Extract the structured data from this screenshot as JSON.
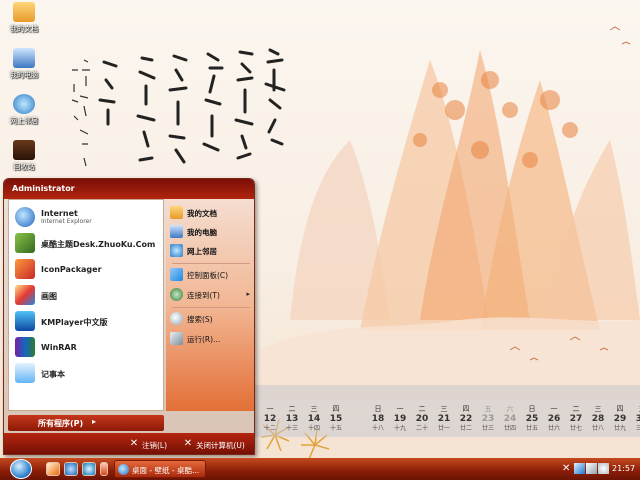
{
  "desktop_icons": [
    {
      "label": "我的文档",
      "icon": "folder-icon"
    },
    {
      "label": "我的电脑",
      "icon": "computer-icon"
    },
    {
      "label": "网上邻居",
      "icon": "network-icon"
    },
    {
      "label": "回收站",
      "icon": "recycle-bin-icon"
    }
  ],
  "start_menu": {
    "user": "Administrator",
    "programs": [
      {
        "title": "Internet",
        "subtitle": "Internet Explorer",
        "icon": "internet-explorer-icon"
      },
      {
        "title": "桌酷主题Desk.ZhuoKu.Com",
        "subtitle": "",
        "icon": "zhuoku-icon"
      },
      {
        "title": "IconPackager",
        "subtitle": "",
        "icon": "iconpackager-icon"
      },
      {
        "title": "画图",
        "subtitle": "",
        "icon": "paint-icon"
      },
      {
        "title": "KMPlayer中文版",
        "subtitle": "",
        "icon": "kmplayer-icon"
      },
      {
        "title": "WinRAR",
        "subtitle": "",
        "icon": "winrar-icon"
      },
      {
        "title": "记事本",
        "subtitle": "",
        "icon": "notepad-icon"
      }
    ],
    "all_programs": "所有程序(P)",
    "right_items": [
      {
        "label": "我的文档",
        "icon": "folder-icon"
      },
      {
        "label": "我的电脑",
        "icon": "computer-icon"
      },
      {
        "label": "网上邻居",
        "icon": "network-icon"
      },
      {
        "label": "控制面板(C)",
        "icon": "control-panel-icon"
      },
      {
        "label": "连接到(T)",
        "icon": "connect-icon",
        "arrow": "▸"
      },
      {
        "label": "搜索(S)",
        "icon": "search-icon"
      },
      {
        "label": "运行(R)...",
        "icon": "run-icon"
      }
    ],
    "logoff": "注销(L)",
    "shutdown": "关闭计算机(U)"
  },
  "calendar": {
    "days": [
      {
        "weekday": "一",
        "day": "12",
        "lunar": "十二",
        "faded": false
      },
      {
        "weekday": "二",
        "day": "13",
        "lunar": "十三",
        "faded": false
      },
      {
        "weekday": "三",
        "day": "14",
        "lunar": "十四",
        "faded": false
      },
      {
        "weekday": "四",
        "day": "15",
        "lunar": "十五",
        "faded": false
      },
      {
        "weekday": "日",
        "day": "18",
        "lunar": "十八",
        "faded": false
      },
      {
        "weekday": "一",
        "day": "19",
        "lunar": "十九",
        "faded": false
      },
      {
        "weekday": "二",
        "day": "20",
        "lunar": "二十",
        "faded": false
      },
      {
        "weekday": "三",
        "day": "21",
        "lunar": "廿一",
        "faded": false
      },
      {
        "weekday": "四",
        "day": "22",
        "lunar": "廿二",
        "faded": false
      },
      {
        "weekday": "五",
        "day": "23",
        "lunar": "廿三",
        "faded": true
      },
      {
        "weekday": "六",
        "day": "24",
        "lunar": "廿四",
        "faded": true
      },
      {
        "weekday": "日",
        "day": "25",
        "lunar": "廿五",
        "faded": false
      },
      {
        "weekday": "一",
        "day": "26",
        "lunar": "廿六",
        "faded": false
      },
      {
        "weekday": "二",
        "day": "27",
        "lunar": "廿七",
        "faded": false
      },
      {
        "weekday": "三",
        "day": "28",
        "lunar": "廿八",
        "faded": false
      },
      {
        "weekday": "四",
        "day": "29",
        "lunar": "廿九",
        "faded": false
      },
      {
        "weekday": "五",
        "day": "30",
        "lunar": "三十",
        "faded": false
      }
    ]
  },
  "taskbar": {
    "task_button": "桌面 - 壁纸 - 桌酷...",
    "clock": "21:57"
  },
  "colors": {
    "accent": "#b1250e",
    "taskbar": "#8a1d08"
  }
}
